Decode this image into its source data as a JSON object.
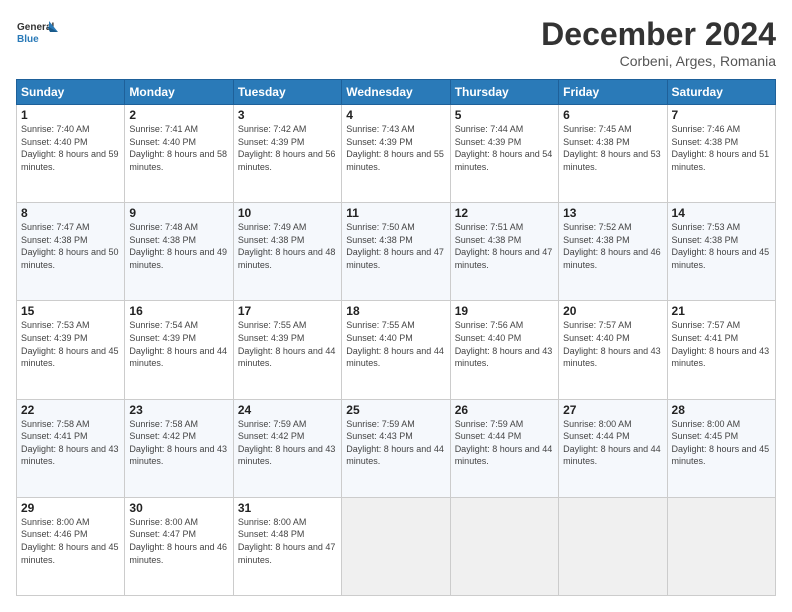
{
  "logo": {
    "line1": "General",
    "line2": "Blue"
  },
  "title": "December 2024",
  "location": "Corbeni, Arges, Romania",
  "days_of_week": [
    "Sunday",
    "Monday",
    "Tuesday",
    "Wednesday",
    "Thursday",
    "Friday",
    "Saturday"
  ],
  "weeks": [
    [
      {
        "day": "1",
        "sunrise": "7:40 AM",
        "sunset": "4:40 PM",
        "daylight": "8 hours and 59 minutes."
      },
      {
        "day": "2",
        "sunrise": "7:41 AM",
        "sunset": "4:40 PM",
        "daylight": "8 hours and 58 minutes."
      },
      {
        "day": "3",
        "sunrise": "7:42 AM",
        "sunset": "4:39 PM",
        "daylight": "8 hours and 56 minutes."
      },
      {
        "day": "4",
        "sunrise": "7:43 AM",
        "sunset": "4:39 PM",
        "daylight": "8 hours and 55 minutes."
      },
      {
        "day": "5",
        "sunrise": "7:44 AM",
        "sunset": "4:39 PM",
        "daylight": "8 hours and 54 minutes."
      },
      {
        "day": "6",
        "sunrise": "7:45 AM",
        "sunset": "4:38 PM",
        "daylight": "8 hours and 53 minutes."
      },
      {
        "day": "7",
        "sunrise": "7:46 AM",
        "sunset": "4:38 PM",
        "daylight": "8 hours and 51 minutes."
      }
    ],
    [
      {
        "day": "8",
        "sunrise": "7:47 AM",
        "sunset": "4:38 PM",
        "daylight": "8 hours and 50 minutes."
      },
      {
        "day": "9",
        "sunrise": "7:48 AM",
        "sunset": "4:38 PM",
        "daylight": "8 hours and 49 minutes."
      },
      {
        "day": "10",
        "sunrise": "7:49 AM",
        "sunset": "4:38 PM",
        "daylight": "8 hours and 48 minutes."
      },
      {
        "day": "11",
        "sunrise": "7:50 AM",
        "sunset": "4:38 PM",
        "daylight": "8 hours and 47 minutes."
      },
      {
        "day": "12",
        "sunrise": "7:51 AM",
        "sunset": "4:38 PM",
        "daylight": "8 hours and 47 minutes."
      },
      {
        "day": "13",
        "sunrise": "7:52 AM",
        "sunset": "4:38 PM",
        "daylight": "8 hours and 46 minutes."
      },
      {
        "day": "14",
        "sunrise": "7:53 AM",
        "sunset": "4:38 PM",
        "daylight": "8 hours and 45 minutes."
      }
    ],
    [
      {
        "day": "15",
        "sunrise": "7:53 AM",
        "sunset": "4:39 PM",
        "daylight": "8 hours and 45 minutes."
      },
      {
        "day": "16",
        "sunrise": "7:54 AM",
        "sunset": "4:39 PM",
        "daylight": "8 hours and 44 minutes."
      },
      {
        "day": "17",
        "sunrise": "7:55 AM",
        "sunset": "4:39 PM",
        "daylight": "8 hours and 44 minutes."
      },
      {
        "day": "18",
        "sunrise": "7:55 AM",
        "sunset": "4:40 PM",
        "daylight": "8 hours and 44 minutes."
      },
      {
        "day": "19",
        "sunrise": "7:56 AM",
        "sunset": "4:40 PM",
        "daylight": "8 hours and 43 minutes."
      },
      {
        "day": "20",
        "sunrise": "7:57 AM",
        "sunset": "4:40 PM",
        "daylight": "8 hours and 43 minutes."
      },
      {
        "day": "21",
        "sunrise": "7:57 AM",
        "sunset": "4:41 PM",
        "daylight": "8 hours and 43 minutes."
      }
    ],
    [
      {
        "day": "22",
        "sunrise": "7:58 AM",
        "sunset": "4:41 PM",
        "daylight": "8 hours and 43 minutes."
      },
      {
        "day": "23",
        "sunrise": "7:58 AM",
        "sunset": "4:42 PM",
        "daylight": "8 hours and 43 minutes."
      },
      {
        "day": "24",
        "sunrise": "7:59 AM",
        "sunset": "4:42 PM",
        "daylight": "8 hours and 43 minutes."
      },
      {
        "day": "25",
        "sunrise": "7:59 AM",
        "sunset": "4:43 PM",
        "daylight": "8 hours and 44 minutes."
      },
      {
        "day": "26",
        "sunrise": "7:59 AM",
        "sunset": "4:44 PM",
        "daylight": "8 hours and 44 minutes."
      },
      {
        "day": "27",
        "sunrise": "8:00 AM",
        "sunset": "4:44 PM",
        "daylight": "8 hours and 44 minutes."
      },
      {
        "day": "28",
        "sunrise": "8:00 AM",
        "sunset": "4:45 PM",
        "daylight": "8 hours and 45 minutes."
      }
    ],
    [
      {
        "day": "29",
        "sunrise": "8:00 AM",
        "sunset": "4:46 PM",
        "daylight": "8 hours and 45 minutes."
      },
      {
        "day": "30",
        "sunrise": "8:00 AM",
        "sunset": "4:47 PM",
        "daylight": "8 hours and 46 minutes."
      },
      {
        "day": "31",
        "sunrise": "8:00 AM",
        "sunset": "4:48 PM",
        "daylight": "8 hours and 47 minutes."
      },
      null,
      null,
      null,
      null
    ]
  ]
}
